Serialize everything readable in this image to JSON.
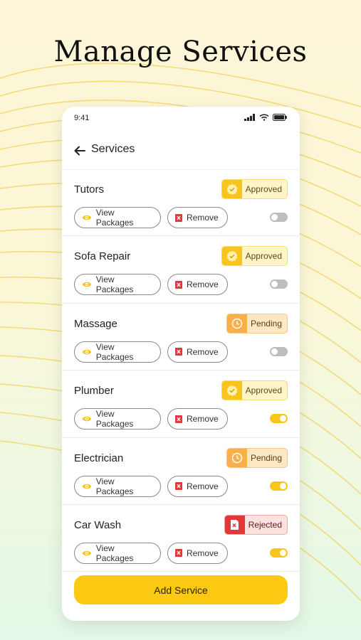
{
  "headline": "Manage Services",
  "status_bar": {
    "time": "9:41"
  },
  "header": {
    "title": "Services"
  },
  "colors": {
    "accent_yellow": "#fcca12",
    "approved": "#f9c41b",
    "pending": "#f7b04a",
    "rejected": "#e23838"
  },
  "services": [
    {
      "name": "Tutors",
      "status": "Approved",
      "status_type": "approved",
      "view_label": "View Packages",
      "remove_label": "Remove",
      "enabled": false
    },
    {
      "name": "Sofa Repair",
      "status": "Approved",
      "status_type": "approved",
      "view_label": "View Packages",
      "remove_label": "Remove",
      "enabled": false
    },
    {
      "name": "Massage",
      "status": "Pending",
      "status_type": "pending",
      "view_label": "View Packages",
      "remove_label": "Remove",
      "enabled": false
    },
    {
      "name": "Plumber",
      "status": "Approved",
      "status_type": "approved",
      "view_label": "View Packages",
      "remove_label": "Remove",
      "enabled": true
    },
    {
      "name": "Electrician",
      "status": "Pending",
      "status_type": "pending",
      "view_label": "View Packages",
      "remove_label": "Remove",
      "enabled": true
    },
    {
      "name": "Car Wash",
      "status": "Rejected",
      "status_type": "rejected",
      "view_label": "View Packages",
      "remove_label": "Remove",
      "enabled": true
    }
  ],
  "add_button_label": "Add Service",
  "icons": {
    "back": "arrow-left-icon",
    "view": "eye-icon",
    "remove": "close-icon",
    "approved": "check-badge-icon",
    "pending": "clock-icon",
    "rejected": "document-x-icon"
  }
}
